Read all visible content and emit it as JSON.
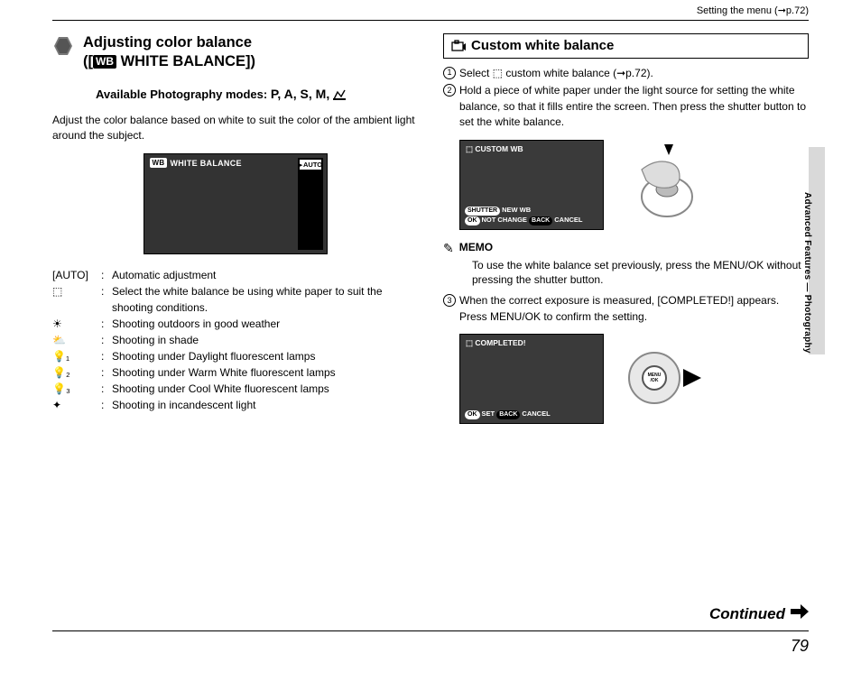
{
  "header": {
    "breadcrumb": "Setting the menu (➞p.72)"
  },
  "side_label": "Advanced Features — Photography",
  "left": {
    "title_l1": "Adjusting color balance",
    "title_l2_pre": "([",
    "title_l2_badge": "WB",
    "title_l2_post": " WHITE BALANCE])",
    "sub_label": "Available Photography modes:",
    "sub_modes": " P, A, S, M, ",
    "intro": "Adjust the color balance based on white to suit the color of the ambient light around the subject.",
    "lcd_title": "WHITE BALANCE",
    "lcd_auto": "AUTO",
    "defs": [
      {
        "k": "[AUTO]",
        "v": "Automatic adjustment"
      },
      {
        "k": "⬚",
        "v": "Select the white balance be using white paper to suit the shooting conditions."
      },
      {
        "k": "☀",
        "v": "Shooting outdoors in good weather"
      },
      {
        "k": "⛅",
        "v": "Shooting in shade"
      },
      {
        "k": "💡₁",
        "v": "Shooting under Daylight fluorescent lamps"
      },
      {
        "k": "💡₂",
        "v": "Shooting under Warm White fluorescent lamps"
      },
      {
        "k": "💡₃",
        "v": "Shooting under Cool White fluorescent lamps"
      },
      {
        "k": "✦",
        "v": "Shooting in incandescent light"
      }
    ]
  },
  "right": {
    "box_title": "Custom white balance",
    "step1": "Select ⬚ custom white balance (➞p.72).",
    "step2": "Hold a piece of white paper under the light source for setting the white balance, so that it fills entire the screen. Then press the shutter button to set the white balance.",
    "lcd2_title": "CUSTOM WB",
    "lcd2_line1_pill": "SHUTTER",
    "lcd2_line1_text": "NEW WB",
    "lcd2_line2_pill1": "OK",
    "lcd2_line2_text1": "NOT CHANGE",
    "lcd2_line2_pill2": "BACK",
    "lcd2_line2_text2": "CANCEL",
    "memo_label": "MEMO",
    "memo_text": "To use the white balance set previously, press the MENU/OK without pressing the shutter button.",
    "step3": "When the correct exposure is measured, [COMPLETED!] appears. Press MENU/OK to confirm the setting.",
    "lcd3_title": "COMPLETED!",
    "lcd3_pill1": "OK",
    "lcd3_text1": "SET",
    "lcd3_pill2": "BACK",
    "lcd3_text2": "CANCEL"
  },
  "footer": {
    "continued": "Continued",
    "page_number": "79"
  }
}
